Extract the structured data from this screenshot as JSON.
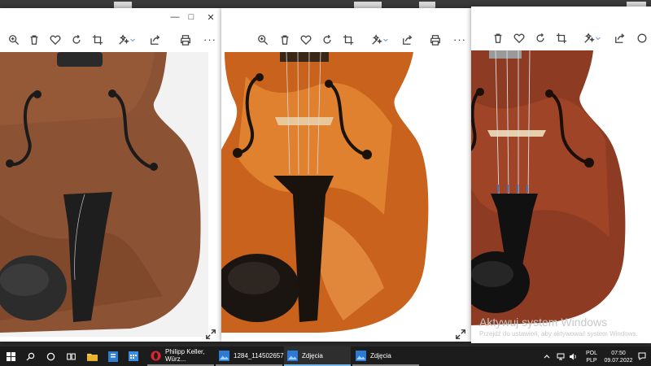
{
  "colors": {
    "taskbar_bg": "#1c1c1c",
    "window_bg": "#ffffff",
    "active_indicator": "#76b9ed",
    "wood_light": "#d9741e",
    "wood_medium": "#a45a2c",
    "wood_dark": "#7a4126",
    "chinrest": "#1a1a1a"
  },
  "windows": [
    {
      "app": "Zdjęcia",
      "toolbar_icons": [
        "zoom-icon",
        "delete-icon",
        "heart-icon",
        "rotate-icon",
        "crop-icon",
        "edit-icon",
        "share-icon",
        "print-icon",
        "more-icon"
      ],
      "more_label": "···"
    },
    {
      "app": "Zdjęcia",
      "toolbar_icons": [
        "zoom-icon",
        "delete-icon",
        "heart-icon",
        "rotate-icon",
        "crop-icon",
        "edit-icon",
        "share-icon",
        "print-icon",
        "more-icon"
      ],
      "more_label": "···"
    },
    {
      "app": "Zdjęcia",
      "toolbar_icons": [
        "delete-icon",
        "heart-icon",
        "rotate-icon",
        "crop-icon",
        "edit-icon",
        "share-icon",
        "more-icon"
      ],
      "watermark_title": "Aktywuj system Windows",
      "watermark_sub": "Przejdź do ustawień, aby aktywować system Windows."
    }
  ],
  "taskbar": {
    "tasks": [
      {
        "label": "Philipp Keller, Würz...",
        "icon": "opera-icon",
        "state": "open"
      },
      {
        "label": "1284_11450265788...",
        "icon": "photos-icon",
        "state": "open"
      },
      {
        "label": "Zdjęcia",
        "icon": "photos-icon",
        "state": "active"
      },
      {
        "label": "Zdjęcia",
        "icon": "photos-icon",
        "state": "open"
      }
    ],
    "tray": {
      "lang_top": "POL",
      "lang_bottom": "PLP",
      "time": "07:50",
      "date": "09.07.2022"
    }
  }
}
